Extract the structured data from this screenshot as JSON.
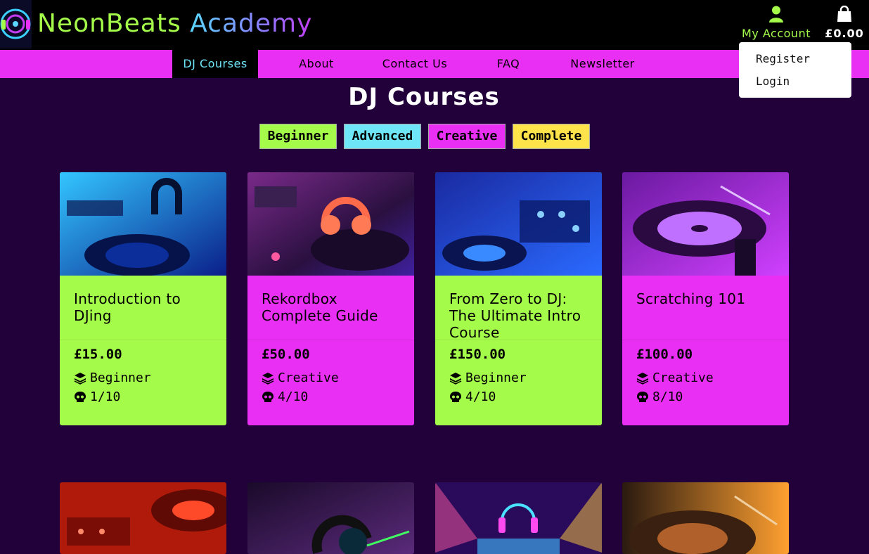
{
  "brand": {
    "word1": "NeonBeats",
    "word2": "Academy"
  },
  "header": {
    "account_label": "My Account",
    "bag_total": "£0.00",
    "account_menu": [
      "Register",
      "Login"
    ]
  },
  "nav": {
    "items": [
      "DJ Courses",
      "About",
      "Contact Us",
      "FAQ",
      "Newsletter"
    ],
    "active": "DJ Courses"
  },
  "page": {
    "title": "DJ Courses"
  },
  "filters": [
    {
      "label": "Beginner",
      "color": "#a4fb4a"
    },
    {
      "label": "Advanced",
      "color": "#6ee6f7"
    },
    {
      "label": "Creative",
      "color": "#ea2ff4"
    },
    {
      "label": "Complete",
      "color": "#ffe34a"
    }
  ],
  "courses": [
    {
      "title": "Introduction to DJing",
      "price": "£15.00",
      "category": "Beginner",
      "difficulty": "1/10",
      "color": "#a4fb4a"
    },
    {
      "title": "Rekordbox Complete Guide",
      "price": "£50.00",
      "category": "Creative",
      "difficulty": "4/10",
      "color": "#ea2ff4"
    },
    {
      "title": "From Zero to DJ: The Ultimate Intro Course",
      "price": "£150.00",
      "category": "Beginner",
      "difficulty": "4/10",
      "color": "#a4fb4a"
    },
    {
      "title": "Scratching 101",
      "price": "£100.00",
      "category": "Creative",
      "difficulty": "8/10",
      "color": "#ea2ff4"
    }
  ],
  "colors": {
    "background": "#22013b",
    "nav": "#ea2ff4",
    "accent_lime": "#a4fb4a",
    "accent_cyan": "#6ee6f7"
  }
}
